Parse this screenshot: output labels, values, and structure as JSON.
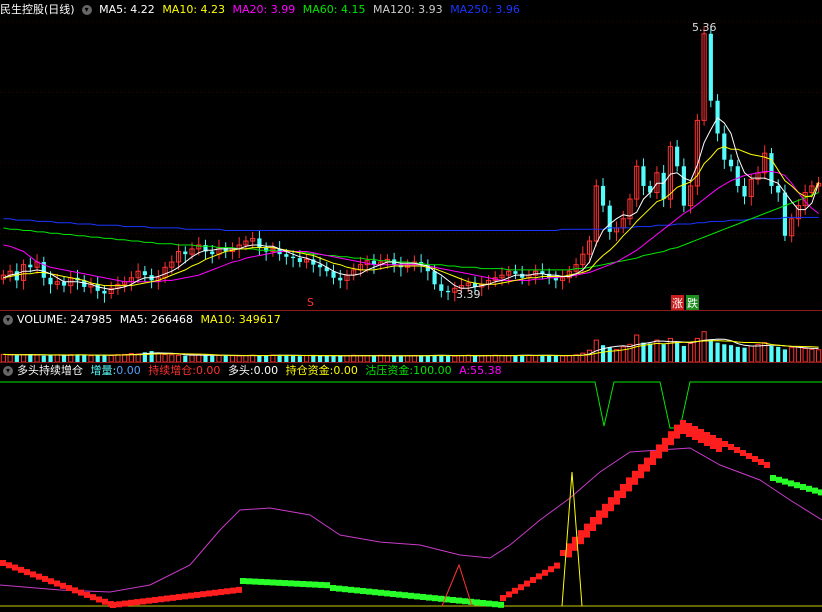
{
  "colors": {
    "up": "#ff3232",
    "down": "#54fcfc",
    "ma5": "#ffffff",
    "ma10": "#ffff00",
    "ma20": "#ff00ff",
    "ma60": "#00e600",
    "ma120": "#cccccc",
    "ma250": "#1a36ff"
  },
  "price_header": {
    "title": "民生控股(日线)",
    "ma5": "MA5: 4.22",
    "ma10": "MA10: 4.23",
    "ma20": "MA20: 3.99",
    "ma60": "MA60: 4.15",
    "ma120": "MA120: 3.93",
    "ma250": "MA250: 3.96"
  },
  "price_panel": {
    "high_label": "5.36",
    "low_label": "3.39",
    "marker_s": "S",
    "marker_zhang": "涨",
    "marker_die": "跌"
  },
  "volume_header": {
    "title": "VOLUME: 247985",
    "ma5": "MA5: 266468",
    "ma10": "MA10: 349617"
  },
  "indicator_header": {
    "title": "多头持续增仓",
    "zl_label": "增量:",
    "zl_val": "0.00",
    "cx_label": "持续增仓:",
    "cx_val": "0.00",
    "dt_label": "多头:",
    "dt_val": "0.00",
    "cc_label": "持仓资金:",
    "cc_val": "0.00",
    "gy_label": "沽压资金:",
    "gy_val": "100.00",
    "a_label": "A:",
    "a_val": "55.38"
  },
  "chart_data": {
    "type": "candlestick",
    "price_range": [
      3.3,
      5.45
    ],
    "closes": [
      3.52,
      3.55,
      3.48,
      3.6,
      3.58,
      3.62,
      3.5,
      3.45,
      3.47,
      3.44,
      3.5,
      3.48,
      3.43,
      3.45,
      3.4,
      3.38,
      3.42,
      3.45,
      3.47,
      3.5,
      3.55,
      3.52,
      3.48,
      3.5,
      3.58,
      3.62,
      3.7,
      3.68,
      3.72,
      3.75,
      3.7,
      3.68,
      3.73,
      3.7,
      3.72,
      3.75,
      3.78,
      3.8,
      3.73,
      3.7,
      3.72,
      3.68,
      3.66,
      3.65,
      3.62,
      3.64,
      3.6,
      3.58,
      3.55,
      3.5,
      3.48,
      3.52,
      3.56,
      3.6,
      3.63,
      3.6,
      3.62,
      3.64,
      3.6,
      3.58,
      3.6,
      3.62,
      3.6,
      3.55,
      3.45,
      3.4,
      3.39,
      3.42,
      3.44,
      3.46,
      3.43,
      3.45,
      3.48,
      3.5,
      3.52,
      3.55,
      3.53,
      3.5,
      3.52,
      3.55,
      3.53,
      3.5,
      3.48,
      3.5,
      3.55,
      3.6,
      3.68,
      3.78,
      4.2,
      4.05,
      3.85,
      3.88,
      3.95,
      4.1,
      4.35,
      4.2,
      4.15,
      4.3,
      4.1,
      4.5,
      4.35,
      4.05,
      4.2,
      4.7,
      5.36,
      4.85,
      4.6,
      4.4,
      4.35,
      4.2,
      4.12,
      4.25,
      4.3,
      4.45,
      4.2,
      4.15,
      3.82,
      3.95,
      4.05,
      4.15,
      4.2,
      4.22
    ],
    "ma5": [
      3.5,
      3.52,
      3.53,
      3.55,
      3.55,
      3.56,
      3.55,
      3.53,
      3.5,
      3.47,
      3.47,
      3.47,
      3.46,
      3.45,
      3.43,
      3.42,
      3.41,
      3.42,
      3.43,
      3.45,
      3.48,
      3.5,
      3.5,
      3.51,
      3.53,
      3.55,
      3.58,
      3.62,
      3.66,
      3.69,
      3.71,
      3.71,
      3.72,
      3.72,
      3.72,
      3.72,
      3.74,
      3.75,
      3.75,
      3.74,
      3.74,
      3.72,
      3.7,
      3.68,
      3.66,
      3.65,
      3.63,
      3.61,
      3.58,
      3.55,
      3.53,
      3.52,
      3.52,
      3.53,
      3.56,
      3.58,
      3.6,
      3.62,
      3.62,
      3.61,
      3.61,
      3.61,
      3.6,
      3.59,
      3.55,
      3.52,
      3.48,
      3.44,
      3.42,
      3.42,
      3.43,
      3.44,
      3.45,
      3.47,
      3.48,
      3.5,
      3.52,
      3.52,
      3.52,
      3.53,
      3.53,
      3.52,
      3.52,
      3.51,
      3.51,
      3.53,
      3.56,
      3.62,
      3.76,
      3.86,
      3.91,
      3.95,
      3.98,
      3.97,
      4.0,
      4.1,
      4.15,
      4.22,
      4.22,
      4.29,
      4.3,
      4.26,
      4.24,
      4.36,
      4.53,
      4.63,
      4.72,
      4.68,
      4.6,
      4.42,
      4.3,
      4.26,
      4.26,
      4.26,
      4.24,
      4.22,
      4.15,
      4.08,
      4.02,
      4.02,
      4.07,
      4.22
    ],
    "ma10": [
      3.5,
      3.51,
      3.52,
      3.53,
      3.53,
      3.54,
      3.54,
      3.53,
      3.52,
      3.51,
      3.5,
      3.49,
      3.48,
      3.46,
      3.45,
      3.44,
      3.44,
      3.44,
      3.44,
      3.44,
      3.45,
      3.46,
      3.47,
      3.48,
      3.5,
      3.52,
      3.54,
      3.56,
      3.59,
      3.61,
      3.64,
      3.66,
      3.68,
      3.7,
      3.71,
      3.72,
      3.72,
      3.73,
      3.73,
      3.73,
      3.73,
      3.72,
      3.71,
      3.7,
      3.69,
      3.68,
      3.67,
      3.65,
      3.63,
      3.61,
      3.6,
      3.58,
      3.57,
      3.56,
      3.56,
      3.56,
      3.57,
      3.58,
      3.59,
      3.59,
      3.59,
      3.59,
      3.59,
      3.58,
      3.57,
      3.55,
      3.53,
      3.51,
      3.49,
      3.47,
      3.46,
      3.45,
      3.45,
      3.45,
      3.46,
      3.47,
      3.48,
      3.49,
      3.5,
      3.5,
      3.51,
      3.51,
      3.51,
      3.51,
      3.52,
      3.53,
      3.54,
      3.56,
      3.62,
      3.67,
      3.71,
      3.76,
      3.82,
      3.87,
      3.93,
      3.98,
      4.03,
      4.08,
      4.1,
      4.14,
      4.19,
      4.21,
      4.23,
      4.28,
      4.37,
      4.42,
      4.48,
      4.5,
      4.48,
      4.48,
      4.46,
      4.44,
      4.43,
      4.42,
      4.4,
      4.32,
      4.24,
      4.2,
      4.15,
      4.12,
      4.12,
      4.23
    ],
    "ma20": [
      3.75,
      3.74,
      3.72,
      3.7,
      3.66,
      3.62,
      3.6,
      3.58,
      3.57,
      3.56,
      3.55,
      3.54,
      3.53,
      3.52,
      3.51,
      3.5,
      3.49,
      3.48,
      3.47,
      3.47,
      3.47,
      3.47,
      3.47,
      3.47,
      3.48,
      3.48,
      3.49,
      3.5,
      3.51,
      3.52,
      3.54,
      3.56,
      3.58,
      3.6,
      3.62,
      3.63,
      3.65,
      3.66,
      3.67,
      3.68,
      3.69,
      3.7,
      3.7,
      3.7,
      3.7,
      3.7,
      3.69,
      3.68,
      3.67,
      3.66,
      3.65,
      3.64,
      3.63,
      3.62,
      3.61,
      3.6,
      3.6,
      3.6,
      3.6,
      3.6,
      3.6,
      3.6,
      3.6,
      3.59,
      3.58,
      3.57,
      3.56,
      3.55,
      3.54,
      3.53,
      3.52,
      3.51,
      3.5,
      3.49,
      3.48,
      3.48,
      3.48,
      3.48,
      3.48,
      3.49,
      3.49,
      3.5,
      3.5,
      3.51,
      3.51,
      3.52,
      3.53,
      3.54,
      3.56,
      3.58,
      3.6,
      3.62,
      3.65,
      3.68,
      3.71,
      3.75,
      3.79,
      3.83,
      3.87,
      3.91,
      3.95,
      3.99,
      4.02,
      4.06,
      4.1,
      4.14,
      4.18,
      4.21,
      4.24,
      4.26,
      4.28,
      4.29,
      4.3,
      4.31,
      4.31,
      4.3,
      4.28,
      4.22,
      4.15,
      4.08,
      4.03,
      3.99
    ],
    "ma60": [
      3.88,
      3.87,
      3.87,
      3.86,
      3.86,
      3.85,
      3.85,
      3.84,
      3.84,
      3.83,
      3.83,
      3.82,
      3.82,
      3.81,
      3.81,
      3.8,
      3.8,
      3.79,
      3.79,
      3.78,
      3.78,
      3.77,
      3.77,
      3.76,
      3.76,
      3.76,
      3.75,
      3.75,
      3.75,
      3.74,
      3.74,
      3.74,
      3.73,
      3.73,
      3.73,
      3.72,
      3.72,
      3.72,
      3.71,
      3.71,
      3.71,
      3.7,
      3.7,
      3.7,
      3.69,
      3.69,
      3.68,
      3.68,
      3.67,
      3.67,
      3.66,
      3.66,
      3.65,
      3.65,
      3.64,
      3.64,
      3.63,
      3.63,
      3.62,
      3.62,
      3.62,
      3.61,
      3.61,
      3.6,
      3.6,
      3.6,
      3.59,
      3.59,
      3.58,
      3.58,
      3.58,
      3.57,
      3.57,
      3.57,
      3.57,
      3.56,
      3.56,
      3.56,
      3.56,
      3.56,
      3.56,
      3.56,
      3.56,
      3.56,
      3.56,
      3.57,
      3.57,
      3.58,
      3.59,
      3.6,
      3.61,
      3.62,
      3.63,
      3.64,
      3.65,
      3.67,
      3.68,
      3.69,
      3.7,
      3.72,
      3.73,
      3.75,
      3.77,
      3.79,
      3.81,
      3.83,
      3.85,
      3.87,
      3.89,
      3.91,
      3.93,
      3.95,
      3.97,
      3.99,
      4.01,
      4.03,
      4.05,
      4.07,
      4.09,
      4.11,
      4.13,
      4.15
    ],
    "ma250": [
      3.95,
      3.95,
      3.94,
      3.94,
      3.94,
      3.93,
      3.93,
      3.93,
      3.92,
      3.92,
      3.92,
      3.91,
      3.91,
      3.91,
      3.9,
      3.9,
      3.9,
      3.9,
      3.89,
      3.89,
      3.89,
      3.89,
      3.88,
      3.88,
      3.88,
      3.88,
      3.88,
      3.87,
      3.87,
      3.87,
      3.87,
      3.87,
      3.87,
      3.86,
      3.86,
      3.86,
      3.86,
      3.86,
      3.86,
      3.86,
      3.86,
      3.86,
      3.86,
      3.86,
      3.86,
      3.86,
      3.86,
      3.86,
      3.86,
      3.86,
      3.86,
      3.86,
      3.86,
      3.86,
      3.86,
      3.86,
      3.86,
      3.86,
      3.86,
      3.86,
      3.86,
      3.86,
      3.86,
      3.86,
      3.86,
      3.86,
      3.86,
      3.86,
      3.86,
      3.86,
      3.86,
      3.86,
      3.86,
      3.86,
      3.86,
      3.86,
      3.86,
      3.86,
      3.86,
      3.86,
      3.86,
      3.86,
      3.86,
      3.87,
      3.87,
      3.87,
      3.87,
      3.87,
      3.87,
      3.87,
      3.88,
      3.88,
      3.88,
      3.88,
      3.89,
      3.89,
      3.89,
      3.9,
      3.9,
      3.9,
      3.91,
      3.91,
      3.91,
      3.92,
      3.92,
      3.93,
      3.93,
      3.93,
      3.94,
      3.94,
      3.94,
      3.95,
      3.95,
      3.95,
      3.95,
      3.95,
      3.96,
      3.96,
      3.96,
      3.96,
      3.96,
      3.96
    ],
    "volume": [
      180,
      170,
      160,
      175,
      190,
      165,
      150,
      155,
      170,
      160,
      175,
      180,
      160,
      150,
      170,
      165,
      155,
      175,
      180,
      200,
      190,
      230,
      260,
      200,
      180,
      170,
      160,
      150,
      165,
      170,
      160,
      150,
      155,
      160,
      150,
      145,
      150,
      160,
      155,
      150,
      165,
      170,
      160,
      150,
      140,
      150,
      160,
      150,
      145,
      140,
      150,
      155,
      160,
      150,
      145,
      150,
      160,
      150,
      145,
      140,
      150,
      155,
      160,
      150,
      165,
      160,
      150,
      140,
      150,
      160,
      150,
      145,
      150,
      160,
      155,
      150,
      160,
      165,
      160,
      150,
      155,
      160,
      150,
      145,
      150,
      170,
      210,
      280,
      520,
      400,
      350,
      300,
      360,
      420,
      640,
      460,
      440,
      520,
      420,
      560,
      480,
      380,
      440,
      560,
      720,
      540,
      460,
      420,
      400,
      360,
      340,
      380,
      420,
      460,
      380,
      360,
      300,
      340,
      360,
      320,
      300,
      290
    ],
    "vol_range": [
      0,
      760
    ],
    "ind_red_pivot": 0.58
  }
}
